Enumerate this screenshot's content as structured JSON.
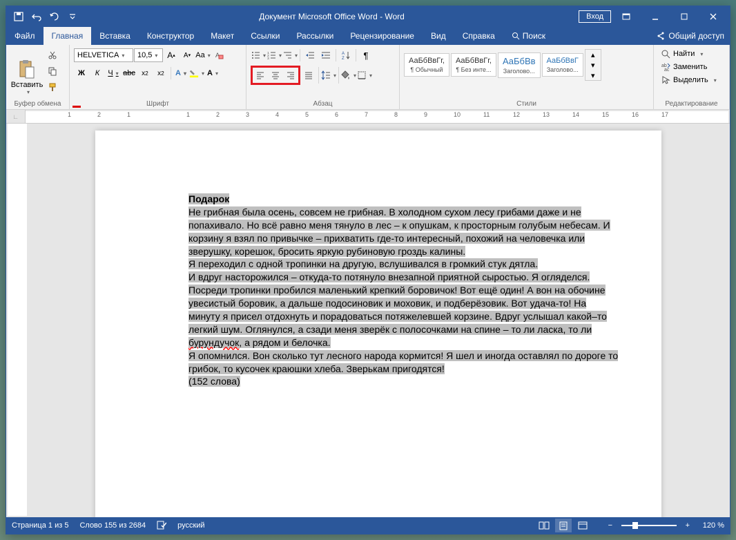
{
  "titlebar": {
    "title": "Документ Microsoft Office Word  -  Word",
    "signin": "Вход"
  },
  "tabs": {
    "file": "Файл",
    "home": "Главная",
    "insert": "Вставка",
    "design": "Конструктор",
    "layout": "Макет",
    "references": "Ссылки",
    "mailings": "Рассылки",
    "review": "Рецензирование",
    "view": "Вид",
    "help": "Справка",
    "search": "Поиск",
    "share": "Общий доступ"
  },
  "ribbon": {
    "clipboard": {
      "label": "Буфер обмена",
      "paste": "Вставить"
    },
    "font": {
      "label": "Шрифт",
      "family": "HELVETICA",
      "size": "10,5"
    },
    "paragraph": {
      "label": "Абзац"
    },
    "styles": {
      "label": "Стили",
      "items": [
        {
          "preview": "АаБбВвГг,",
          "name": "¶ Обычный"
        },
        {
          "preview": "АаБбВвГг,",
          "name": "¶ Без инте..."
        },
        {
          "preview": "АаБбВв",
          "name": "Заголово..."
        },
        {
          "preview": "АаБбВвГ",
          "name": "Заголово..."
        }
      ]
    },
    "editing": {
      "label": "Редактирование",
      "find": "Найти",
      "replace": "Заменить",
      "select": "Выделить"
    }
  },
  "document": {
    "title": "Подарок",
    "p1": "Не грибная была осень, совсем не грибная. В холодном сухом лесу грибами даже и не попахивало. Но всё равно меня тянуло в лес – к опушкам, к просторным голубым небесам. И корзину я взял по привычке – прихватить где-то интересный, похожий на человечка или зверушку, корешок, бросить яркую рубиновую гроздь калины.",
    "p2": "Я переходил с одной тропинки на другую, вслушивался в громкий стук дятла.",
    "p3a": "И вдруг насторожился – откуда-то потянуло внезапной приятной сыростью. Я огляделся. Посреди тропинки пробился маленький крепкий боровичок! Вот ещё один! А вон на обочине увесистый боровик, а дальше подосиновик и моховик, и подберёзовик. Вот удача-то! На минуту я присел отдохнуть и порадоваться потяжелевшей корзине. Вдруг услышал какой–то легкий шум. Оглянулся, а сзади меня зверёк с полосочками на спине – то ли ласка, то ли ",
    "p3u": "бурундучок",
    "p3b": ", а рядом и белочка.",
    "p4": "Я опомнился. Вон сколько тут лесного народа кормится! Я шел и иногда оставлял по дороге то грибок, то кусочек краюшки хлеба. Зверькам пригодятся!",
    "p5": "(152 слова)"
  },
  "statusbar": {
    "page": "Страница 1 из 5",
    "words": "Слово 155 из 2684",
    "lang": "русский",
    "zoom": "120 %"
  },
  "ruler": {
    "ticks": [
      "",
      "1",
      "2",
      "1",
      "",
      "1",
      "2",
      "3",
      "4",
      "5",
      "6",
      "7",
      "8",
      "9",
      "10",
      "11",
      "12",
      "13",
      "14",
      "15",
      "16",
      "17"
    ]
  }
}
